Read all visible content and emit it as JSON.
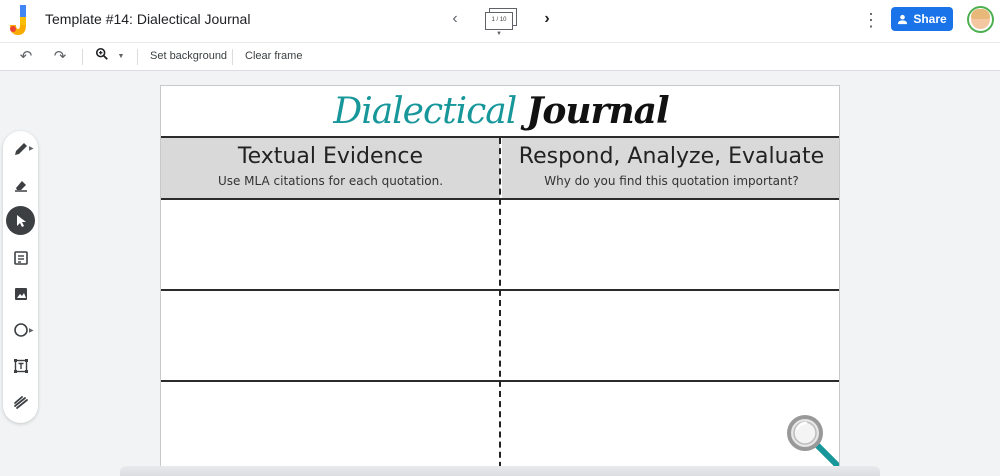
{
  "header": {
    "title": "Template #14: Dialectical Journal",
    "frame_counter": "1 / 10",
    "share_label": "Share"
  },
  "toolbar": {
    "set_background_label": "Set background",
    "clear_frame_label": "Clear frame"
  },
  "tools": [
    {
      "name": "pen",
      "icon": "pen-icon"
    },
    {
      "name": "eraser",
      "icon": "eraser-icon"
    },
    {
      "name": "select",
      "icon": "select-arrow-icon",
      "active": true
    },
    {
      "name": "sticky-note",
      "icon": "sticky-note-icon"
    },
    {
      "name": "image",
      "icon": "image-icon"
    },
    {
      "name": "circle",
      "icon": "circle-icon"
    },
    {
      "name": "text-box",
      "icon": "text-box-icon"
    },
    {
      "name": "laser",
      "icon": "laser-icon"
    }
  ],
  "journal": {
    "title_word1": "Dialectical",
    "title_word2": "Journal",
    "columns": [
      {
        "title": "Textual Evidence",
        "subtitle": "Use MLA citations for each quotation."
      },
      {
        "title": "Respond, Analyze, Evaluate",
        "subtitle": "Why do you find this quotation important?"
      }
    ]
  },
  "colors": {
    "accent": "#1a73e8",
    "title_teal": "#17979a",
    "header_gray": "#d9d9d9"
  }
}
